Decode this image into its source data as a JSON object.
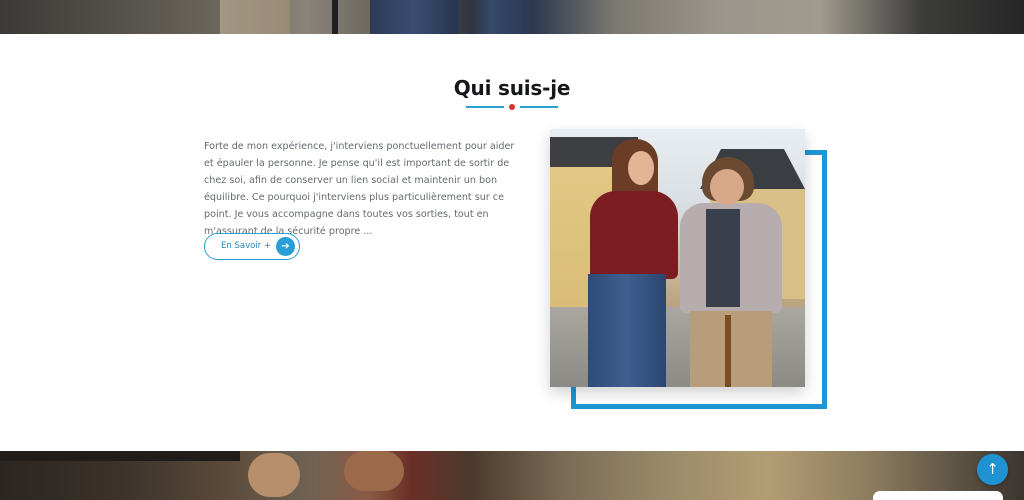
{
  "section": {
    "title": "Qui suis-je",
    "body": "Forte de mon expérience, j'interviens ponctuellement pour aider et épauler la personne. Je pense qu'il est important de sortir de chez soi, afin de conserver un lien social et maintenir un bon équilibre. Ce pourquoi j'interviens plus particulièrement sur ce point. Je vous accompagne dans toutes vos sorties, tout en m'assurant de la sécurité propre ...",
    "button_label": "En Savoir +",
    "button_icon": "arrow-right-icon"
  },
  "scroll_top": {
    "icon": "arrow-up-icon",
    "glyph": "↑"
  },
  "colors": {
    "accent": "#1f96d3",
    "dot": "#d9322a",
    "title": "#15161a",
    "body_text": "#666a70"
  }
}
